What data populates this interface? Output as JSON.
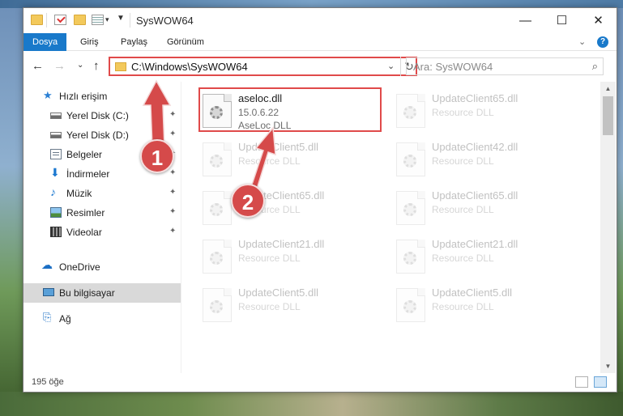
{
  "window": {
    "title": "SysWOW64",
    "minimize": "—",
    "maximize": "☐",
    "close": "✕"
  },
  "ribbon": {
    "tabs": [
      "Dosya",
      "Giriş",
      "Paylaş",
      "Görünüm"
    ],
    "expand": "⌄",
    "help": "?"
  },
  "nav": {
    "back": "←",
    "forward": "→",
    "recent": "⌄",
    "up": "↑",
    "address": "C:\\Windows\\SysWOW64",
    "address_dropdown": "⌄",
    "refresh": "↻",
    "search_placeholder": "Ara: SysWOW64",
    "search_icon": "⌕"
  },
  "sidebar": {
    "items": [
      {
        "label": "Hızlı erişim",
        "icon": "star-icon"
      },
      {
        "label": "Yerel Disk (C:)",
        "icon": "drive-icon",
        "pinned": true
      },
      {
        "label": "Yerel Disk (D:)",
        "icon": "drive-icon",
        "pinned": true
      },
      {
        "label": "Belgeler",
        "icon": "documents-icon",
        "pinned": true
      },
      {
        "label": "İndirmeler",
        "icon": "download-icon",
        "pinned": true
      },
      {
        "label": "Müzik",
        "icon": "music-icon",
        "pinned": true
      },
      {
        "label": "Resimler",
        "icon": "pictures-icon",
        "pinned": true
      },
      {
        "label": "Videolar",
        "icon": "videos-icon",
        "pinned": true
      },
      {
        "label": "OneDrive",
        "icon": "cloud-icon"
      },
      {
        "label": "Bu bilgisayar",
        "icon": "computer-icon"
      },
      {
        "label": "Ağ",
        "icon": "network-icon"
      }
    ],
    "pin_glyph": "📌"
  },
  "files": [
    {
      "name": "aseloc.dll",
      "line2": "15.0.6.22",
      "line3": "AseLoc DLL",
      "highlighted": true
    },
    {
      "name": "UpdateClient65.dll",
      "line2": "Resource DLL"
    },
    {
      "name": "UpdateClient5.dll",
      "line2": "Resource DLL"
    },
    {
      "name": "UpdateClient42.dll",
      "line2": "Resource DLL"
    },
    {
      "name": "UpdateClient65.dll",
      "line2": "Resource DLL"
    },
    {
      "name": "UpdateClient65.dll",
      "line2": "Resource DLL"
    },
    {
      "name": "UpdateClient21.dll",
      "line2": "Resource DLL"
    },
    {
      "name": "UpdateClient21.dll",
      "line2": "Resource DLL"
    },
    {
      "name": "UpdateClient5.dll",
      "line2": "Resource DLL"
    },
    {
      "name": "UpdateClient5.dll",
      "line2": "Resource DLL"
    }
  ],
  "status": {
    "count": "195 öğe"
  },
  "callouts": [
    "1",
    "2"
  ],
  "colors": {
    "accent": "#1979ca",
    "highlight": "#e04a4a",
    "callout": "#d54a4a"
  }
}
